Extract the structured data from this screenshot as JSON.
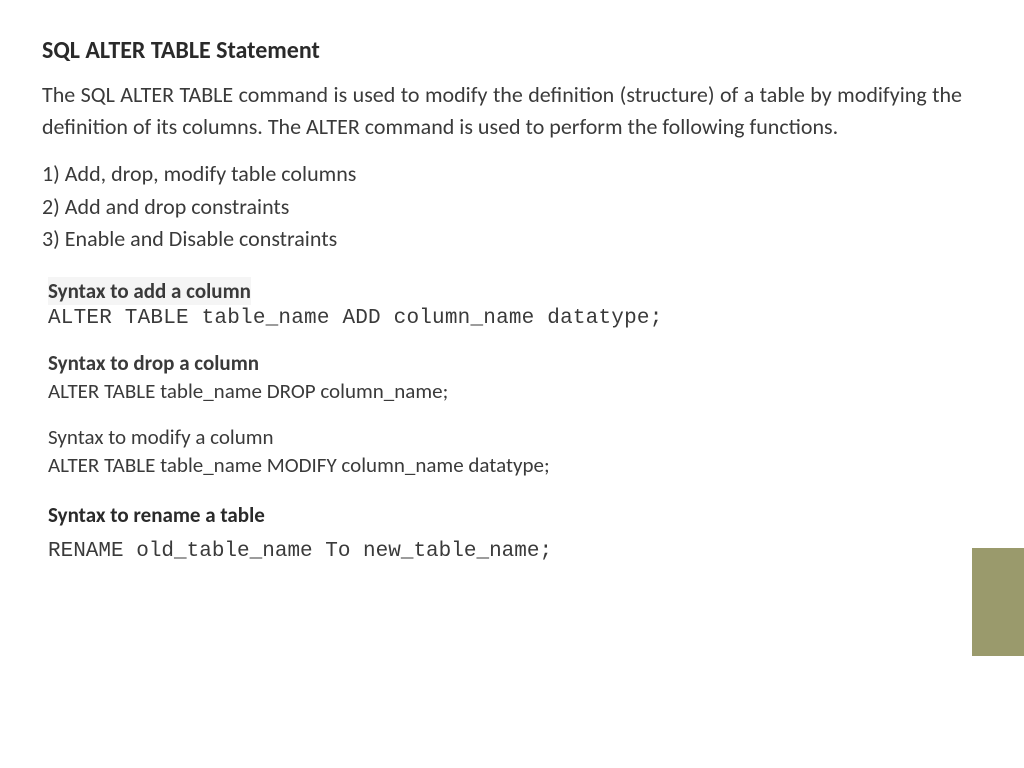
{
  "title": "SQL ALTER TABLE Statement",
  "intro": "The SQL ALTER TABLE command is used to modify the definition (structure) of a table by modifying the definition of its columns. The ALTER command is used to perform the following functions.",
  "list": {
    "item1": "1) Add, drop, modify table columns",
    "item2": "2) Add and drop constraints",
    "item3": "3) Enable and Disable constraints"
  },
  "syntax": {
    "add": {
      "heading": "Syntax to add a column",
      "code": "ALTER TABLE table_name ADD column_name datatype;"
    },
    "drop": {
      "heading": "Syntax to drop a column",
      "code": "ALTER TABLE table_name DROP column_name;"
    },
    "modify": {
      "heading": "Syntax to modify a column",
      "code": "ALTER TABLE table_name MODIFY column_name datatype;"
    },
    "rename": {
      "heading": "Syntax to rename a table",
      "code": "RENAME old_table_name To new_table_name;"
    }
  }
}
